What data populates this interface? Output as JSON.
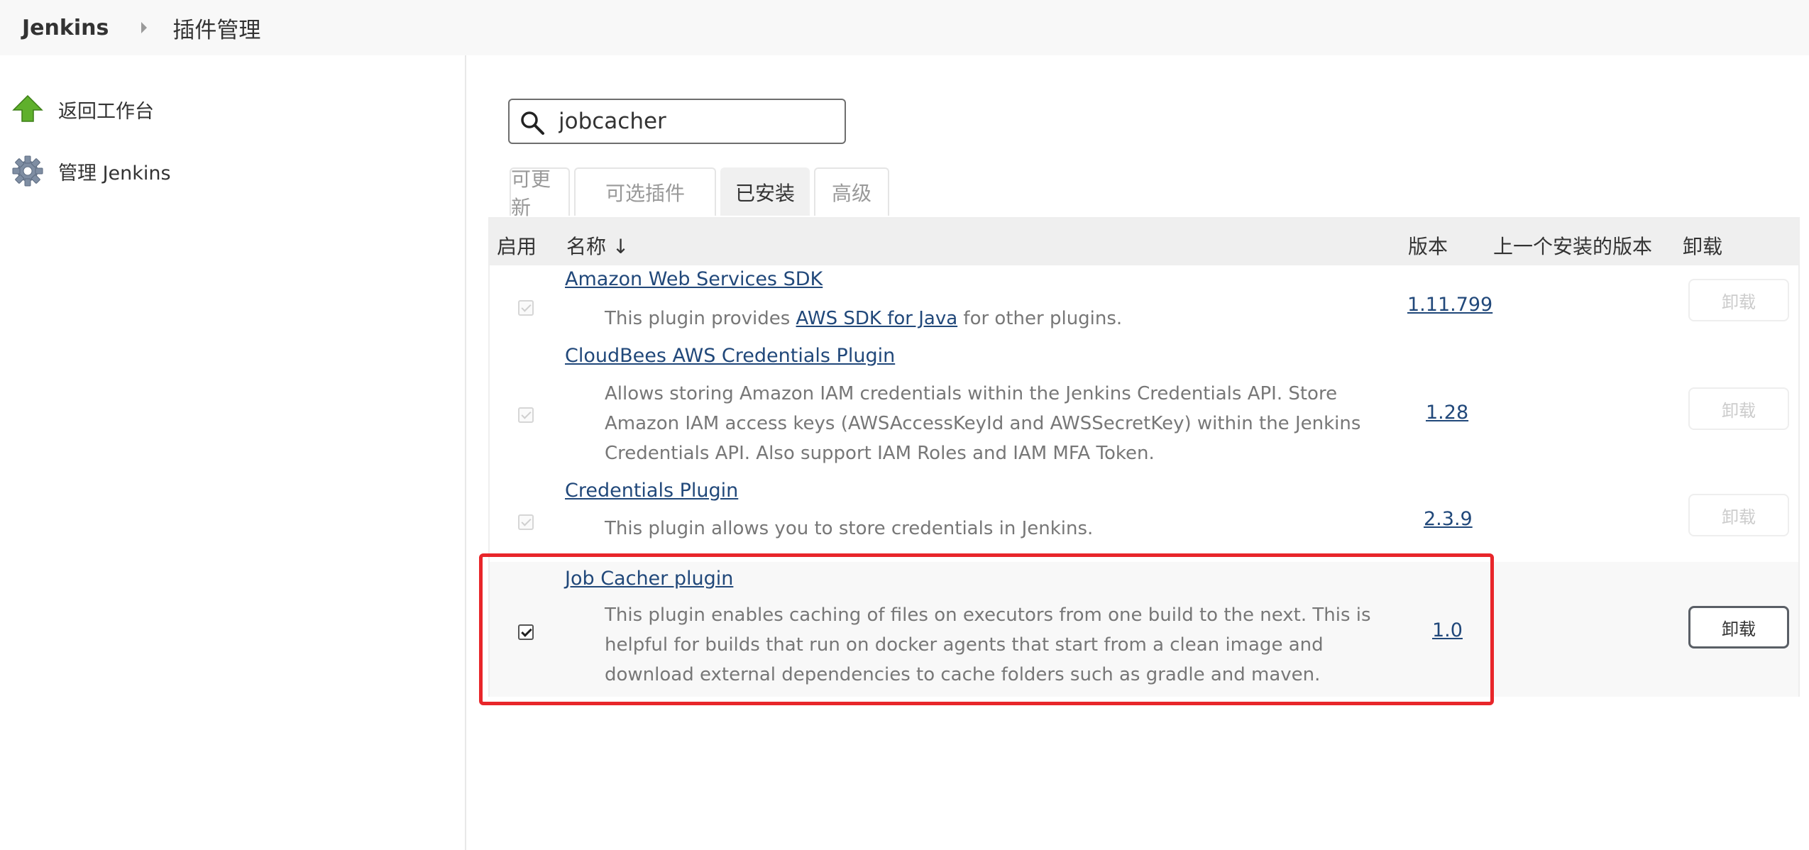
{
  "header": {
    "brand": "Jenkins",
    "breadcrumb": "插件管理"
  },
  "sidebar": {
    "items": [
      {
        "label": "返回工作台",
        "icon": "up-arrow-icon"
      },
      {
        "label": "管理 Jenkins",
        "icon": "gear-icon"
      }
    ]
  },
  "search": {
    "value": "jobcacher",
    "icon": "search-icon"
  },
  "tabs": [
    {
      "label": "可更新",
      "active": false
    },
    {
      "label": "可选插件",
      "active": false
    },
    {
      "label": "已安装",
      "active": true
    },
    {
      "label": "高级",
      "active": false
    }
  ],
  "table": {
    "headers": {
      "enabled": "启用",
      "name": "名称 ↓",
      "version": "版本",
      "previous_version": "上一个安装的版本",
      "uninstall": "卸载"
    },
    "rows": [
      {
        "name": "Amazon Web Services SDK",
        "desc_before": "This plugin provides ",
        "desc_link": "AWS SDK for Java",
        "desc_after": " for other plugins.",
        "version": "1.11.799",
        "enabled": true,
        "uninstall": "卸载"
      },
      {
        "name": "CloudBees AWS Credentials Plugin",
        "desc": "Allows storing Amazon IAM credentials within the Jenkins Credentials API. Store Amazon IAM access keys (AWSAccessKeyId and AWSSecretKey) within the Jenkins Credentials API. Also support IAM Roles and IAM MFA Token.",
        "version": "1.28",
        "enabled": true,
        "uninstall": "卸载"
      },
      {
        "name": "Credentials Plugin",
        "desc": "This plugin allows you to store credentials in Jenkins.",
        "version": "2.3.9",
        "enabled": true,
        "uninstall": "卸载"
      },
      {
        "name": "Job Cacher plugin",
        "desc": "This plugin enables caching of files on executors from one build to the next. This is helpful for builds that run on docker agents that start from a clean image and download external dependencies to cache folders such as gradle and maven.",
        "version": "1.0",
        "enabled": true,
        "uninstall": "卸载"
      }
    ]
  },
  "colors": {
    "highlight": "#e8262a",
    "link": "#21487a"
  }
}
